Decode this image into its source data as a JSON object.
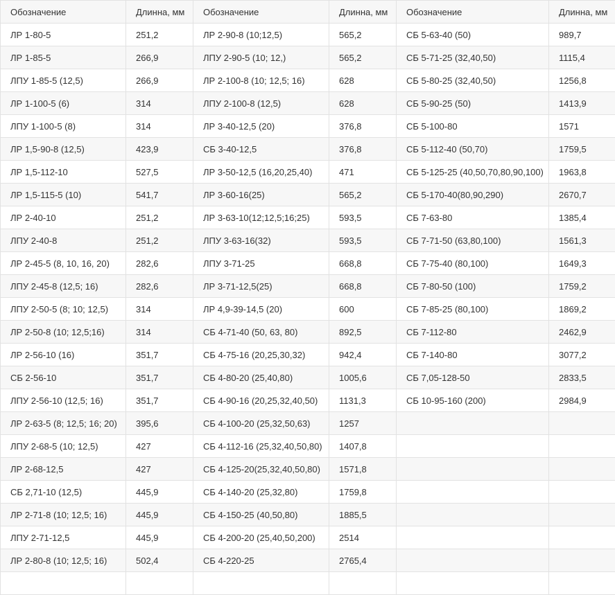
{
  "table": {
    "headers": [
      "Обозначение",
      "Длинна, мм",
      "Обозначение",
      "Длинна, мм",
      "Обозначение",
      "Длинна, мм"
    ],
    "rows": [
      [
        "ЛР 1-80-5",
        "251,2",
        "ЛР 2-90-8 (10;12,5)",
        "565,2",
        "СБ 5-63-40 (50)",
        "989,7"
      ],
      [
        "ЛР 1-85-5",
        "266,9",
        "ЛПУ 2-90-5 (10; 12,)",
        "565,2",
        "СБ 5-71-25 (32,40,50)",
        "1115,4"
      ],
      [
        "ЛПУ 1-85-5 (12,5)",
        "266,9",
        "ЛР 2-100-8 (10; 12,5; 16)",
        "628",
        "СБ 5-80-25 (32,40,50)",
        "1256,8"
      ],
      [
        "ЛР 1-100-5 (6)",
        "314",
        "ЛПУ 2-100-8 (12,5)",
        "628",
        "СБ 5-90-25 (50)",
        "1413,9"
      ],
      [
        "ЛПУ 1-100-5 (8)",
        "314",
        "ЛР 3-40-12,5 (20)",
        "376,8",
        "СБ 5-100-80",
        "1571"
      ],
      [
        "ЛР 1,5-90-8 (12,5)",
        "423,9",
        "СБ 3-40-12,5",
        "376,8",
        "СБ 5-112-40 (50,70)",
        "1759,5"
      ],
      [
        "ЛР 1,5-112-10",
        "527,5",
        "ЛР 3-50-12,5 (16,20,25,40)",
        "471",
        "СБ 5-125-25 (40,50,70,80,90,100)",
        "1963,8"
      ],
      [
        "ЛР 1,5-115-5 (10)",
        "541,7",
        "ЛР 3-60-16(25)",
        "565,2",
        "СБ 5-170-40(80,90,290)",
        "2670,7"
      ],
      [
        "ЛР 2-40-10",
        "251,2",
        "ЛР 3-63-10(12;12,5;16;25)",
        "593,5",
        "СБ 7-63-80",
        "1385,4"
      ],
      [
        "ЛПУ 2-40-8",
        "251,2",
        "ЛПУ 3-63-16(32)",
        "593,5",
        "СБ 7-71-50 (63,80,100)",
        "1561,3"
      ],
      [
        "ЛР 2-45-5 (8, 10, 16, 20)",
        "282,6",
        "ЛПУ 3-71-25",
        "668,8",
        "СБ 7-75-40 (80,100)",
        "1649,3"
      ],
      [
        "ЛПУ 2-45-8 (12,5; 16)",
        "282,6",
        "ЛР 3-71-12,5(25)",
        "668,8",
        "СБ 7-80-50 (100)",
        "1759,2"
      ],
      [
        "ЛПУ 2-50-5 (8; 10; 12,5)",
        "314",
        "ЛР 4,9-39-14,5 (20)",
        "600",
        "СБ 7-85-25 (80,100)",
        "1869,2"
      ],
      [
        "ЛР 2-50-8 (10; 12,5;16)",
        "314",
        "СБ 4-71-40 (50, 63, 80)",
        "892,5",
        "СБ 7-112-80",
        "2462,9"
      ],
      [
        "ЛР 2-56-10 (16)",
        "351,7",
        "СБ 4-75-16 (20,25,30,32)",
        "942,4",
        "СБ 7-140-80",
        "3077,2"
      ],
      [
        "СБ 2-56-10",
        "351,7",
        "СБ 4-80-20 (25,40,80)",
        "1005,6",
        "СБ 7,05-128-50",
        "2833,5"
      ],
      [
        "ЛПУ 2-56-10 (12,5; 16)",
        "351,7",
        "СБ 4-90-16 (20,25,32,40,50)",
        "1131,3",
        "СБ 10-95-160 (200)",
        "2984,9"
      ],
      [
        "ЛР 2-63-5 (8; 12,5; 16; 20)",
        "395,6",
        "СБ 4-100-20 (25,32,50,63)",
        "1257",
        "",
        ""
      ],
      [
        "ЛПУ 2-68-5 (10; 12,5)",
        "427",
        "СБ 4-112-16 (25,32,40,50,80)",
        "1407,8",
        "",
        ""
      ],
      [
        "ЛР 2-68-12,5",
        "427",
        "СБ 4-125-20(25,32,40,50,80)",
        "1571,8",
        "",
        ""
      ],
      [
        "СБ 2,71-10 (12,5)",
        "445,9",
        "СБ 4-140-20 (25,32,80)",
        "1759,8",
        "",
        ""
      ],
      [
        "ЛР 2-71-8 (10; 12,5; 16)",
        "445,9",
        "СБ 4-150-25 (40,50,80)",
        "1885,5",
        "",
        ""
      ],
      [
        "ЛПУ 2-71-12,5",
        "445,9",
        "СБ 4-200-20 (25,40,50,200)",
        "2514",
        "",
        ""
      ],
      [
        "ЛР 2-80-8 (10; 12,5; 16)",
        "502,4",
        "СБ 4-220-25",
        "2765,4",
        "",
        ""
      ],
      [
        "",
        "",
        "",
        "",
        "",
        ""
      ]
    ]
  }
}
